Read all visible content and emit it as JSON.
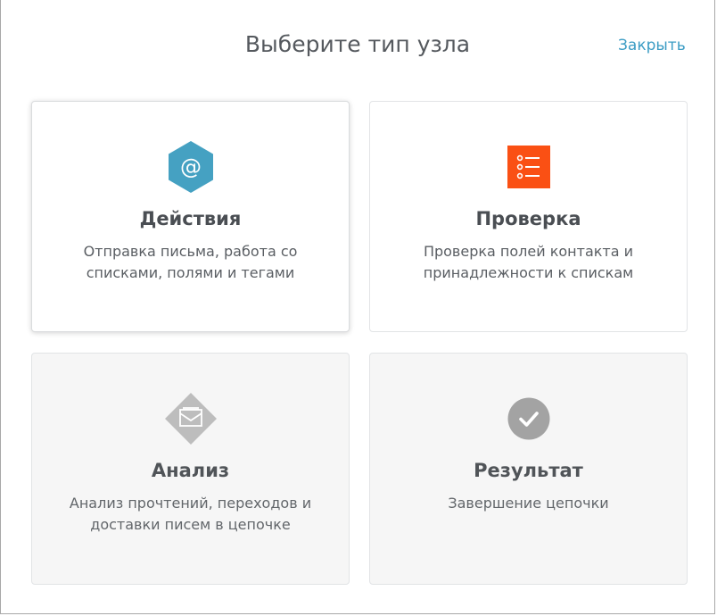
{
  "dialog": {
    "title": "Выберите тип узла",
    "close_label": "Закрыть"
  },
  "cards": [
    {
      "name": "Действия",
      "description": "Отправка письма, работа со списками, полями и тегами",
      "icon": "at-sign-hexagon-icon",
      "icon_color": "#45a1c2",
      "state": "selected"
    },
    {
      "name": "Проверка",
      "description": "Проверка полей контакта и принадлежности к спискам",
      "icon": "checklist-icon",
      "icon_color": "#fa5014",
      "state": "normal"
    },
    {
      "name": "Анализ",
      "description": "Анализ прочтений, переходов и доставки писем в цепочке",
      "icon": "envelope-diamond-icon",
      "icon_color": "#bdbdbd",
      "state": "disabled"
    },
    {
      "name": "Результат",
      "description": "Завершение цепочки",
      "icon": "checkmark-circle-icon",
      "icon_color": "#a3a3a3",
      "state": "disabled"
    }
  ],
  "colors": {
    "accent": "#3b9cc4",
    "title": "#55595e",
    "card_border": "#e2e4e6",
    "disabled_background": "#f6f6f6"
  }
}
